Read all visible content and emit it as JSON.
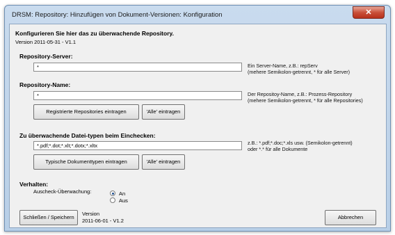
{
  "window": {
    "title": "DRSM: Repository: Hinzufügen von Dokument-Versionen: Konfiguration",
    "close_glyph": "✕"
  },
  "header": {
    "title": "Konfigurieren Sie hier  das zu überwachende Repository.",
    "version": "Version 2011-05-31 - V1.1"
  },
  "server": {
    "label": "Repository-Server:",
    "value": "*",
    "hint_line1": "Ein Server-Name, z.B.: repServ",
    "hint_line2": "(mehere Semikolon-getrennt, * für alle Server)"
  },
  "repo": {
    "label": "Repository-Name:",
    "value": "*",
    "hint_line1": "Der Repositoy-Name, z.B.: Prozess-Repository",
    "hint_line2": "(mehere Semikolon-getrennt, * für alle Repositories)",
    "register_button": "Registrierte Repositories eintragen",
    "all_button": "'Alle' eintragen"
  },
  "filetypes": {
    "label": "Zu überwachende Datei-typen beim Einchecken:",
    "value": "*.pdf;*.dot;*.xlt;*.dotx;*.xltx",
    "hint_line1": "z.B.: *.pdf;*.doc;*.xls usw. (Semikolon-getrennt)",
    "hint_line2": "oder *.* für alle Dokumente",
    "typical_button": "Typische Dokumenttypen eintragen",
    "all_button": "'Alle' eintragen"
  },
  "behavior": {
    "label": "Verhalten:",
    "checkout_label": "Auscheck-Überwachung:",
    "option_on": "An",
    "option_off": "Aus",
    "selected": "An"
  },
  "footer": {
    "close_save_button": "Schließen / Speichern",
    "version_label": "Version",
    "version_value": "2011-06-01 - V1.2",
    "cancel_button": "Abbrechen"
  }
}
